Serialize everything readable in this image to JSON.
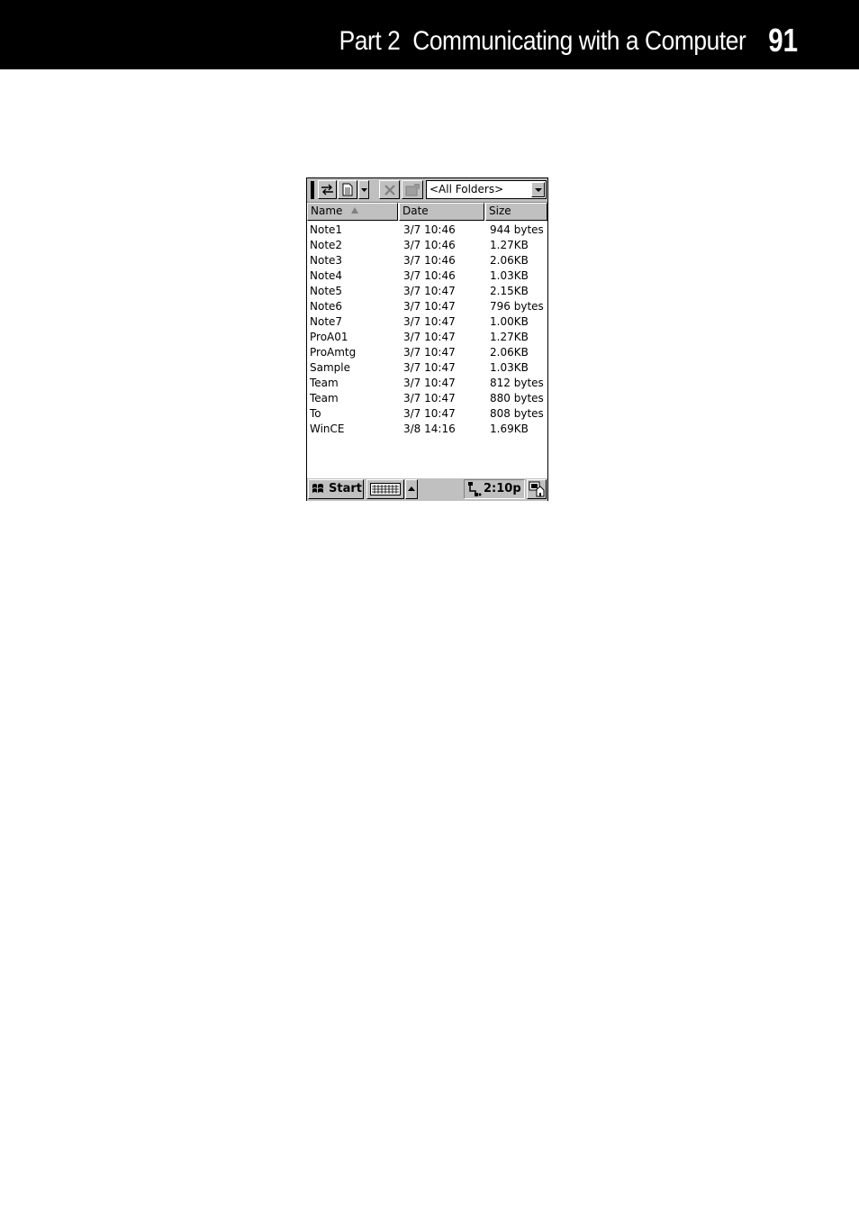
{
  "page_header": {
    "title": "Part 2  Communicating with a Computer",
    "page_number": "91"
  },
  "toolbar": {
    "icons": [
      "sync-icon",
      "new-document-icon",
      "dropdown-arrow-icon",
      "delete-icon",
      "properties-icon"
    ],
    "folder_filter": "<All Folders>"
  },
  "columns": [
    {
      "label": "Name",
      "sort": "ascending"
    },
    {
      "label": "Date"
    },
    {
      "label": "Size"
    }
  ],
  "files": [
    {
      "name": "Note1",
      "date": "3/7 10:46",
      "size": "944 bytes"
    },
    {
      "name": "Note2",
      "date": "3/7 10:46",
      "size": "1.27KB"
    },
    {
      "name": "Note3",
      "date": "3/7 10:46",
      "size": "2.06KB"
    },
    {
      "name": "Note4",
      "date": "3/7 10:46",
      "size": "1.03KB"
    },
    {
      "name": "Note5",
      "date": "3/7 10:47",
      "size": "2.15KB"
    },
    {
      "name": "Note6",
      "date": "3/7 10:47",
      "size": "796 bytes"
    },
    {
      "name": "Note7",
      "date": "3/7 10:47",
      "size": "1.00KB"
    },
    {
      "name": "ProA01",
      "date": "3/7 10:47",
      "size": "1.27KB"
    },
    {
      "name": "ProAmtg",
      "date": "3/7 10:47",
      "size": "2.06KB"
    },
    {
      "name": "Sample",
      "date": "3/7 10:47",
      "size": "1.03KB"
    },
    {
      "name": "Team",
      "date": "3/7 10:47",
      "size": "812 bytes"
    },
    {
      "name": "Team",
      "date": "3/7 10:47",
      "size": "880 bytes"
    },
    {
      "name": "To",
      "date": "3/7 10:47",
      "size": "808 bytes"
    },
    {
      "name": "WinCE",
      "date": "3/8 14:16",
      "size": "1.69KB"
    }
  ],
  "taskbar": {
    "start_label": "Start",
    "clock": "2:10p"
  }
}
